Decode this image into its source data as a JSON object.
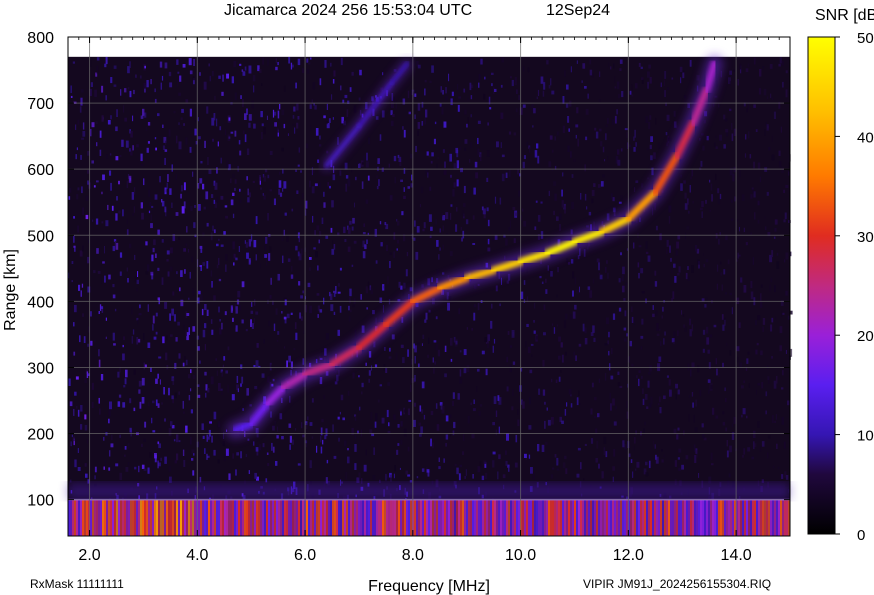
{
  "header": {
    "title": "Jicamarca 2024 256 15:53:04 UTC",
    "date": "12Sep24"
  },
  "footer": {
    "rxmask": "RxMask 11111111",
    "file": "VIPIR  JM91J_2024256155304.RIQ"
  },
  "colorbar": {
    "label": "SNR [dB]",
    "ticks": [
      0,
      10,
      20,
      30,
      40,
      50
    ],
    "range": [
      0,
      50
    ]
  },
  "chart_data": {
    "type": "heatmap",
    "title": "Jicamarca 2024 256 15:53:04 UTC",
    "xlabel": "Frequency [MHz]",
    "ylabel": "Range [km]",
    "xlim": [
      1.6,
      15.0
    ],
    "ylim": [
      45,
      800
    ],
    "xticks": [
      "2.0",
      "4.0",
      "6.0",
      "8.0",
      "10.0",
      "12.0",
      "14.0"
    ],
    "yticks": [
      "100",
      "200",
      "300",
      "400",
      "500",
      "600",
      "700",
      "800"
    ],
    "grid": true,
    "colors": [
      "#000000",
      "#2a0b55",
      "#5a1fd0",
      "#9a20c8",
      "#d02a2a",
      "#ff8a00",
      "#ffff00"
    ],
    "trace": [
      {
        "f": 4.7,
        "r": 205,
        "snr": 14
      },
      {
        "f": 5.0,
        "r": 215,
        "snr": 15
      },
      {
        "f": 5.3,
        "r": 245,
        "snr": 18
      },
      {
        "f": 5.6,
        "r": 270,
        "snr": 21
      },
      {
        "f": 6.0,
        "r": 290,
        "snr": 24
      },
      {
        "f": 6.5,
        "r": 305,
        "snr": 26
      },
      {
        "f": 7.0,
        "r": 330,
        "snr": 28
      },
      {
        "f": 7.5,
        "r": 365,
        "snr": 30
      },
      {
        "f": 8.0,
        "r": 400,
        "snr": 32
      },
      {
        "f": 8.5,
        "r": 420,
        "snr": 36
      },
      {
        "f": 9.0,
        "r": 435,
        "snr": 40
      },
      {
        "f": 9.5,
        "r": 447,
        "snr": 43
      },
      {
        "f": 10.0,
        "r": 460,
        "snr": 45
      },
      {
        "f": 10.5,
        "r": 473,
        "snr": 48
      },
      {
        "f": 11.0,
        "r": 490,
        "snr": 50
      },
      {
        "f": 11.5,
        "r": 505,
        "snr": 46
      },
      {
        "f": 12.0,
        "r": 525,
        "snr": 42
      },
      {
        "f": 12.5,
        "r": 565,
        "snr": 36
      },
      {
        "f": 12.9,
        "r": 620,
        "snr": 30
      },
      {
        "f": 13.2,
        "r": 670,
        "snr": 26
      },
      {
        "f": 13.45,
        "r": 720,
        "snr": 22
      },
      {
        "f": 13.6,
        "r": 760,
        "snr": 20
      }
    ],
    "faint_trace": [
      {
        "f": 6.4,
        "r": 605,
        "snr": 12
      },
      {
        "f": 7.0,
        "r": 665,
        "snr": 12
      },
      {
        "f": 7.6,
        "r": 730,
        "snr": 11
      },
      {
        "f": 7.9,
        "r": 760,
        "snr": 10
      }
    ],
    "low_band": {
      "range_min": 45,
      "range_max": 100,
      "snr": 25
    },
    "noise_floor": {
      "range_min": 100,
      "range_max": 770,
      "snr": 6
    }
  }
}
